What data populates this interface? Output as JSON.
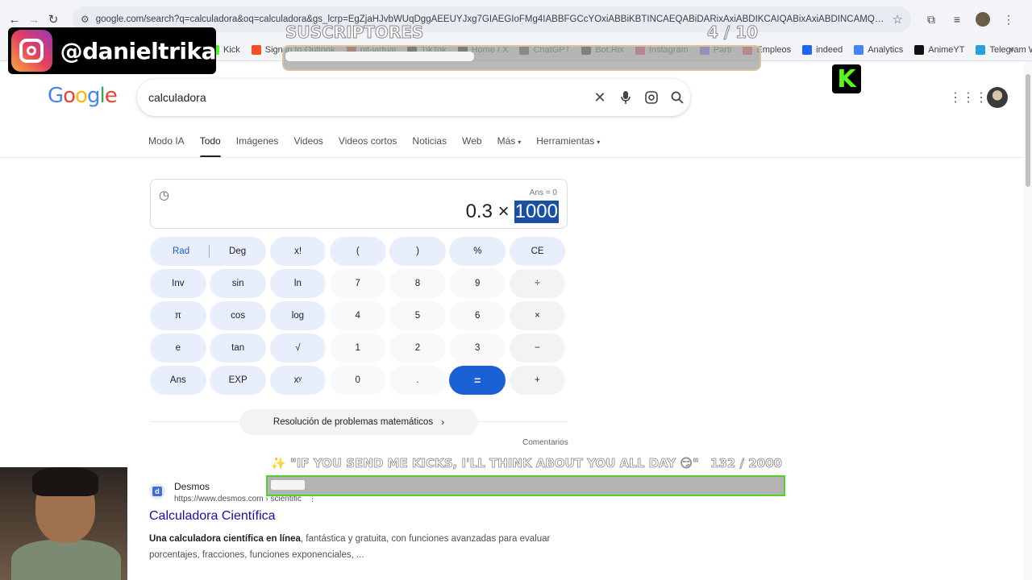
{
  "browser": {
    "url": "google.com/search?q=calculadora&oq=calculadora&gs_lcrp=EgZjaHJvbWUqDggAEEUYJxg7GIAEGIoFMg4IABBFGCcYOxiABBiKBTINCAEQABiDARixAxiABDIKCAIQABixAxiABDINCAMQABiDARixAxiAB...",
    "bookmarks": [
      {
        "label": "Kick",
        "color": "#53fc18"
      },
      {
        "label": "Sign in to Outlook",
        "color": "#f25022"
      },
      {
        "label": "pit-virtual",
        "color": "#c0392b"
      },
      {
        "label": "TikTok",
        "color": "#111111"
      },
      {
        "label": "Home / X",
        "color": "#111111"
      },
      {
        "label": "ChatGPT",
        "color": "#444444"
      },
      {
        "label": "Bot.Rix",
        "color": "#222222"
      },
      {
        "label": "Instagram",
        "color": "#e4405f"
      },
      {
        "label": "Parti",
        "color": "#7b61ff"
      },
      {
        "label": "Empleos",
        "color": "#e74c3c"
      },
      {
        "label": "indeed",
        "color": "#2164f3"
      },
      {
        "label": "Analytics",
        "color": "#4285f4"
      },
      {
        "label": "AnimeYT",
        "color": "#111111"
      },
      {
        "label": "Telegram Web",
        "color": "#2aa1da"
      }
    ]
  },
  "overlays": {
    "instagram_handle": "@danieltrika",
    "subs_title": "SUSCRIPTORES",
    "subs_count": "4 / 10",
    "subs_progress": 0.4,
    "kicks_message": "✨ \"IF YOU SEND ME KICKS, I'LL THINK ABOUT YOU ALL DAY 😏\"",
    "kicks_count": "132 / 2000",
    "kicks_progress": 0.066,
    "kick_logo": "K"
  },
  "google": {
    "query": "calculadora",
    "tabs": [
      {
        "label": "Modo IA",
        "active": false
      },
      {
        "label": "Todo",
        "active": true
      },
      {
        "label": "Imágenes",
        "active": false
      },
      {
        "label": "Videos",
        "active": false
      },
      {
        "label": "Videos cortos",
        "active": false
      },
      {
        "label": "Noticias",
        "active": false
      },
      {
        "label": "Web",
        "active": false
      },
      {
        "label": "Más",
        "active": false,
        "dropdown": true
      },
      {
        "label": "Herramientas",
        "active": false,
        "dropdown": true
      }
    ]
  },
  "calculator": {
    "ans_label": "Ans = 0",
    "expression_left": "0.3 ×",
    "expression_selected": "1000",
    "rad": "Rad",
    "deg": "Deg",
    "keys": [
      [
        "x!",
        "(",
        ")",
        "%",
        "CE"
      ],
      [
        "Inv",
        "sin",
        "ln",
        "7",
        "8",
        "9",
        "÷"
      ],
      [
        "π",
        "cos",
        "log",
        "4",
        "5",
        "6",
        "×"
      ],
      [
        "e",
        "tan",
        "√",
        "1",
        "2",
        "3",
        "−"
      ],
      [
        "Ans",
        "EXP",
        "xʸ",
        "0",
        ".",
        "=",
        "+"
      ]
    ],
    "math_button": "Resolución de problemas matemáticos",
    "comments": "Comentarios"
  },
  "result": {
    "favicon_letter": "d",
    "site": "Desmos",
    "url": "https://www.desmos.com › scientific",
    "title": "Calculadora Científica",
    "snippet_bold": "Una calculadora científica en línea",
    "snippet_rest": ", fantástica y gratuita, con funciones avanzadas para evaluar porcentajes, fracciones, funciones exponenciales, ..."
  }
}
